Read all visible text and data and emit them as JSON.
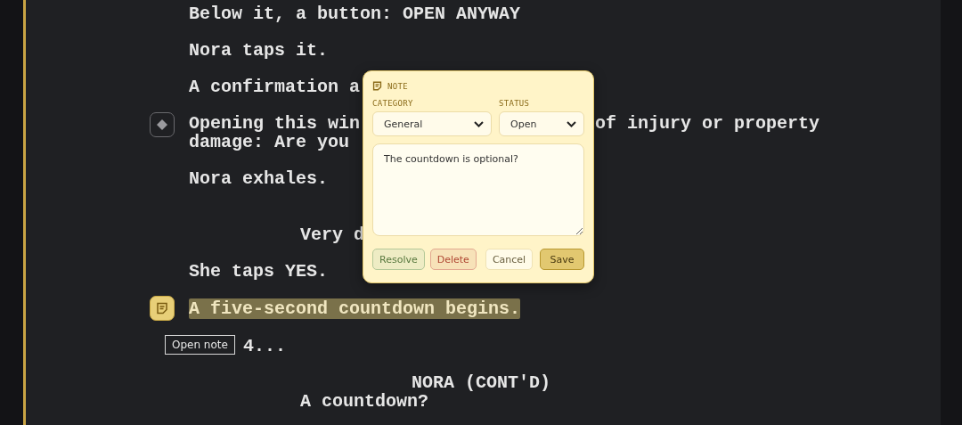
{
  "script_lines": [
    {
      "kind": "action",
      "text": "Below it, a button: OPEN ANYWAY",
      "highlighted": false
    },
    {
      "kind": "action",
      "text": "Nora taps it.",
      "highlighted": false
    },
    {
      "kind": "action",
      "text": "A confirmation a",
      "highlighted": false
    },
    {
      "kind": "action",
      "text": "Opening this win",
      "right_text": "of injury or property",
      "second_line": "damage: Are you",
      "marker": {
        "kind": "diamond"
      },
      "highlighted": false
    },
    {
      "kind": "action",
      "text": "Nora exhales.",
      "highlighted": false
    },
    {
      "kind": "dialogue",
      "text": "Very d",
      "highlighted": false
    },
    {
      "kind": "action",
      "text": "She taps YES.",
      "highlighted": false
    },
    {
      "kind": "action",
      "text": "A five-second countdown begins.",
      "marker": {
        "kind": "note"
      },
      "highlighted": true
    },
    {
      "kind": "beat",
      "text": "4...",
      "highlighted": false
    },
    {
      "kind": "character",
      "text": "NORA (CONT'D)",
      "highlighted": false
    },
    {
      "kind": "dialogue",
      "text": "A countdown?",
      "highlighted": false
    }
  ],
  "tooltip": "Open note",
  "note": {
    "title": "NOTE",
    "category_label": "CATEGORY",
    "category": "General",
    "status_label": "STATUS",
    "status": "Open",
    "text": "The countdown is optional?",
    "buttons": [
      {
        "kind": "resolve",
        "label": "Resolve"
      },
      {
        "kind": "delete",
        "label": "Delete"
      },
      {
        "kind": "cancel",
        "label": "Cancel"
      },
      {
        "kind": "save",
        "label": "Save"
      }
    ]
  }
}
